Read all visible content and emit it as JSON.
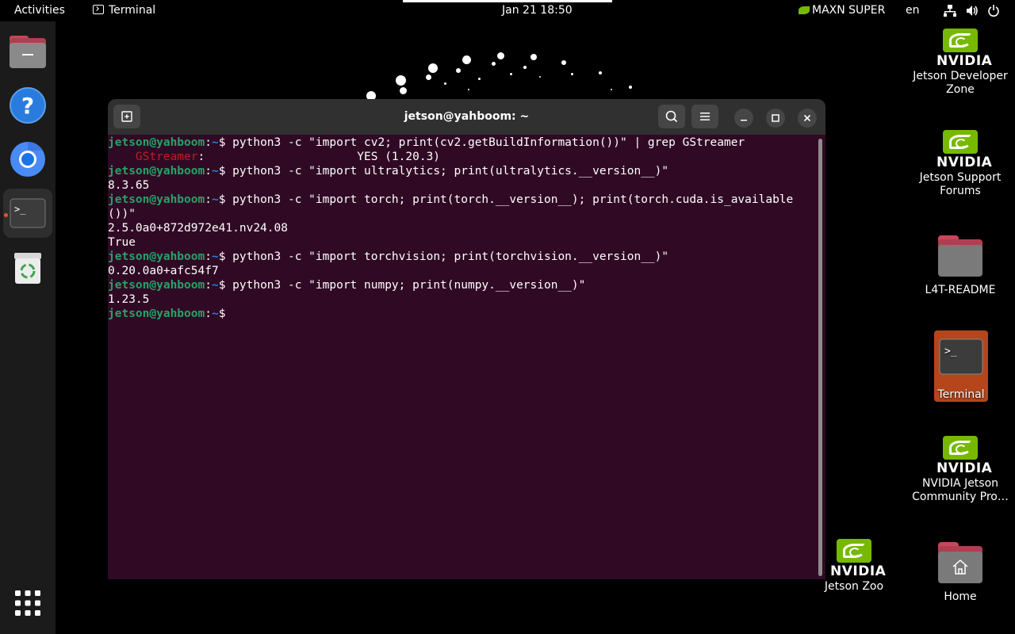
{
  "topbar": {
    "activities": "Activities",
    "app_name": "Terminal",
    "datetime": "Jan 21  18:50",
    "power_mode": "MAXN SUPER",
    "language": "en"
  },
  "dock": {
    "items": [
      "files-icon",
      "help-icon",
      "chromium-icon",
      "terminal-icon",
      "trash-icon",
      "app-grid-icon"
    ]
  },
  "desktop": {
    "icons": [
      {
        "label": "Jetson Developer Zone",
        "brand": "NVIDIA"
      },
      {
        "label": "Jetson Support Forums",
        "brand": "NVIDIA"
      },
      {
        "label": "L4T-README"
      },
      {
        "label": "Terminal"
      },
      {
        "label": "NVIDIA Jetson Community Pro…",
        "brand": "NVIDIA"
      },
      {
        "label": "Jetson Zoo",
        "brand": "NVIDIA"
      },
      {
        "label": "Home"
      }
    ]
  },
  "terminal": {
    "title": "jetson@yahboom: ~",
    "prompt_user": "jetson@yahboom",
    "prompt_sep": ":",
    "prompt_path": "~",
    "prompt_end": "$",
    "lines": [
      {
        "type": "cmd",
        "text": " python3 -c \"import cv2; print(cv2.getBuildInformation())\" | grep GStreamer"
      },
      {
        "type": "gst",
        "indent": "    ",
        "key": "GStreamer",
        "rest": ":                      YES (1.20.3)"
      },
      {
        "type": "cmd",
        "text": " python3 -c \"import ultralytics; print(ultralytics.__version__)\""
      },
      {
        "type": "out",
        "text": "8.3.65"
      },
      {
        "type": "cmd",
        "text": " python3 -c \"import torch; print(torch.__version__); print(torch.cuda.is_available"
      },
      {
        "type": "out",
        "text": "())\""
      },
      {
        "type": "out",
        "text": "2.5.0a0+872d972e41.nv24.08"
      },
      {
        "type": "out",
        "text": "True"
      },
      {
        "type": "cmd",
        "text": " python3 -c \"import torchvision; print(torchvision.__version__)\""
      },
      {
        "type": "out",
        "text": "0.20.0a0+afc54f7"
      },
      {
        "type": "cmd",
        "text": " python3 -c \"import numpy; print(numpy.__version__)\""
      },
      {
        "type": "out",
        "text": "1.23.5"
      },
      {
        "type": "cmd",
        "text": ""
      }
    ]
  },
  "colors": {
    "terminal_bg": "#300a24",
    "prompt_user": "#26a269",
    "prompt_path": "#2a7bde",
    "highlight": "#c01c28",
    "nvidia_green": "#76b900",
    "accent": "#e95420"
  }
}
